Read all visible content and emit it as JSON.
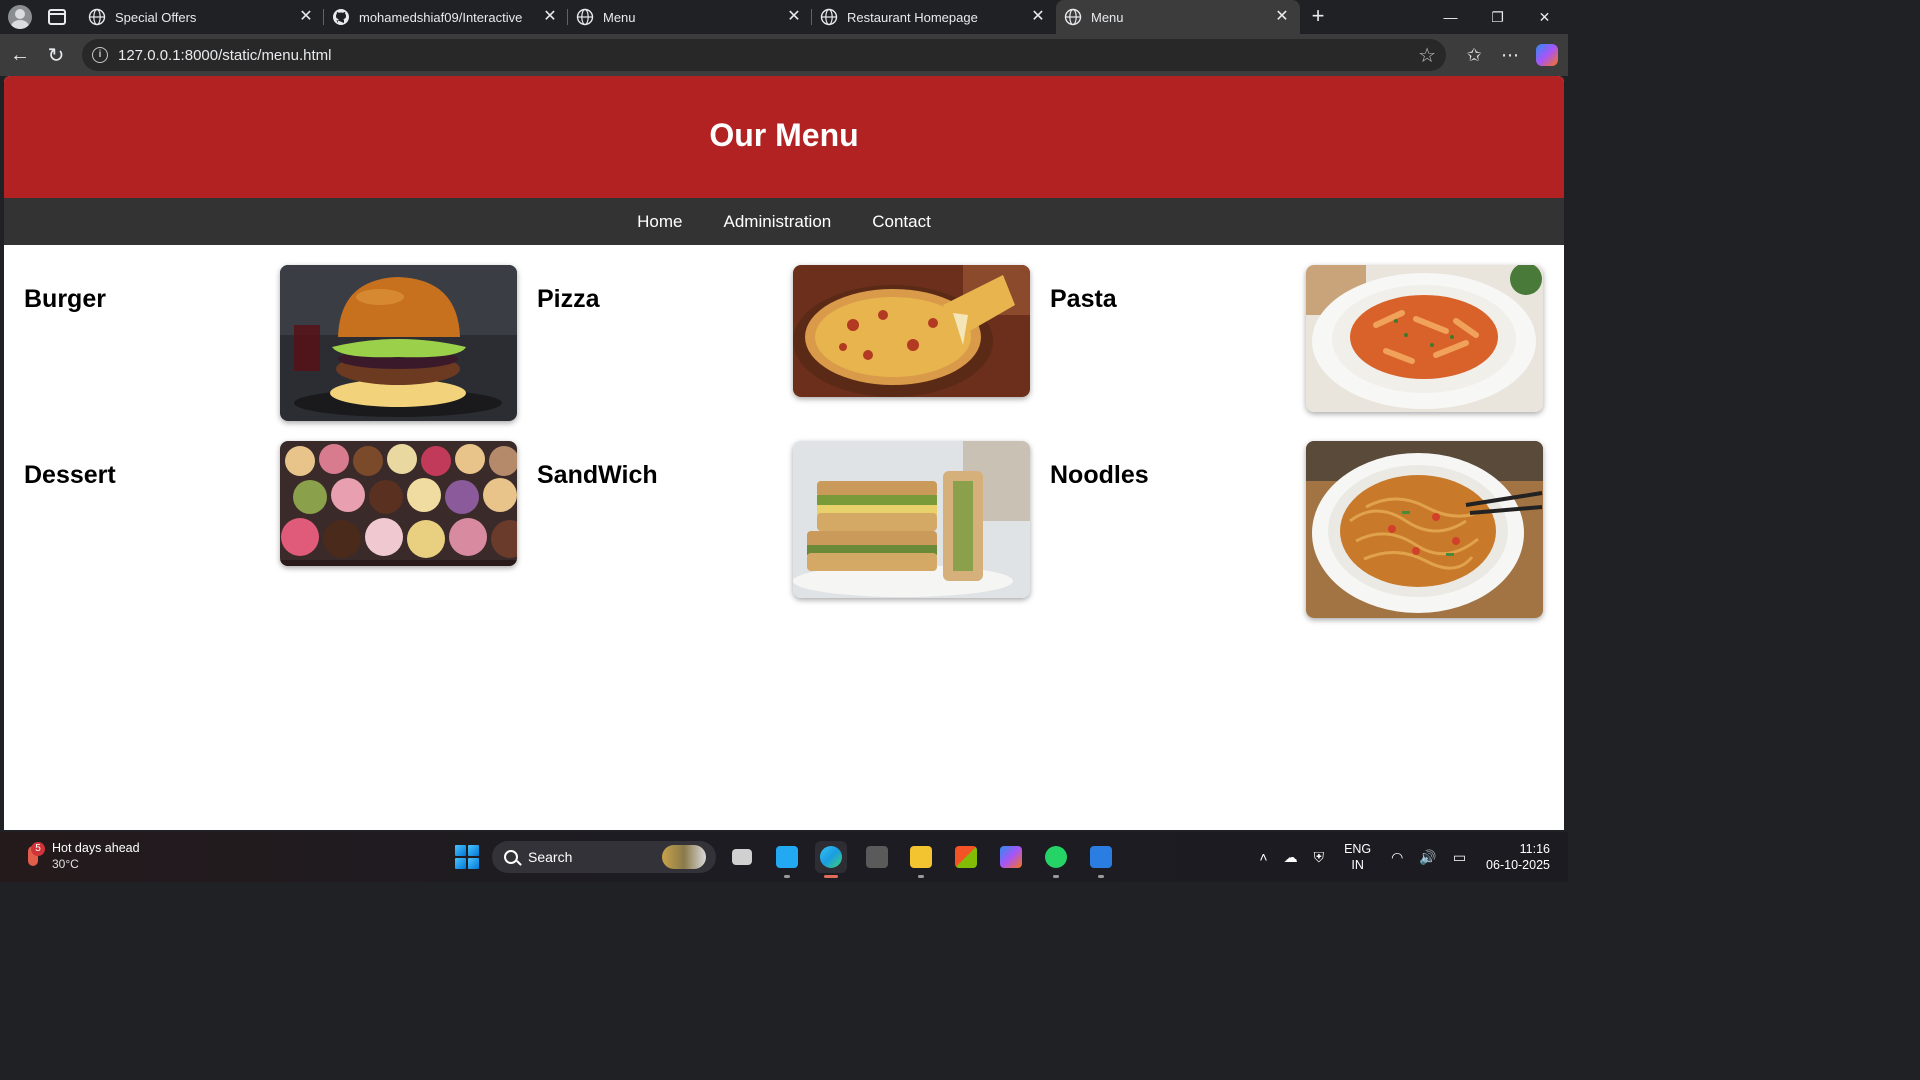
{
  "browser": {
    "tabs": [
      {
        "title": "Special Offers",
        "favicon": "globe-icon",
        "active": false
      },
      {
        "title": "mohamedshiaf09/Interactive",
        "favicon": "github-icon",
        "active": false
      },
      {
        "title": "Menu",
        "favicon": "globe-icon",
        "active": false
      },
      {
        "title": "Restaurant Homepage",
        "favicon": "globe-icon",
        "active": false
      },
      {
        "title": "Menu",
        "favicon": "globe-icon",
        "active": true
      }
    ],
    "url": "127.0.0.1:8000/static/menu.html"
  },
  "page": {
    "header_title": "Our Menu",
    "header_color": "#b22222",
    "nav_color": "#333333",
    "nav": [
      "Home",
      "Administration",
      "Contact"
    ],
    "items": [
      {
        "name": "Burger",
        "image": "burger-image"
      },
      {
        "name": "Pizza",
        "image": "pizza-image"
      },
      {
        "name": "Pasta",
        "image": "pasta-image"
      },
      {
        "name": "Dessert",
        "image": "dessert-image"
      },
      {
        "name": "SandWich",
        "image": "sandwich-image"
      },
      {
        "name": "Noodles",
        "image": "noodles-image"
      }
    ]
  },
  "taskbar": {
    "weather_text": "Hot days ahead",
    "weather_temp": "30°C",
    "weather_badge": "5",
    "search_label": "Search",
    "lang_1": "ENG",
    "lang_2": "IN",
    "time": "11:16",
    "date": "06-10-2025"
  }
}
